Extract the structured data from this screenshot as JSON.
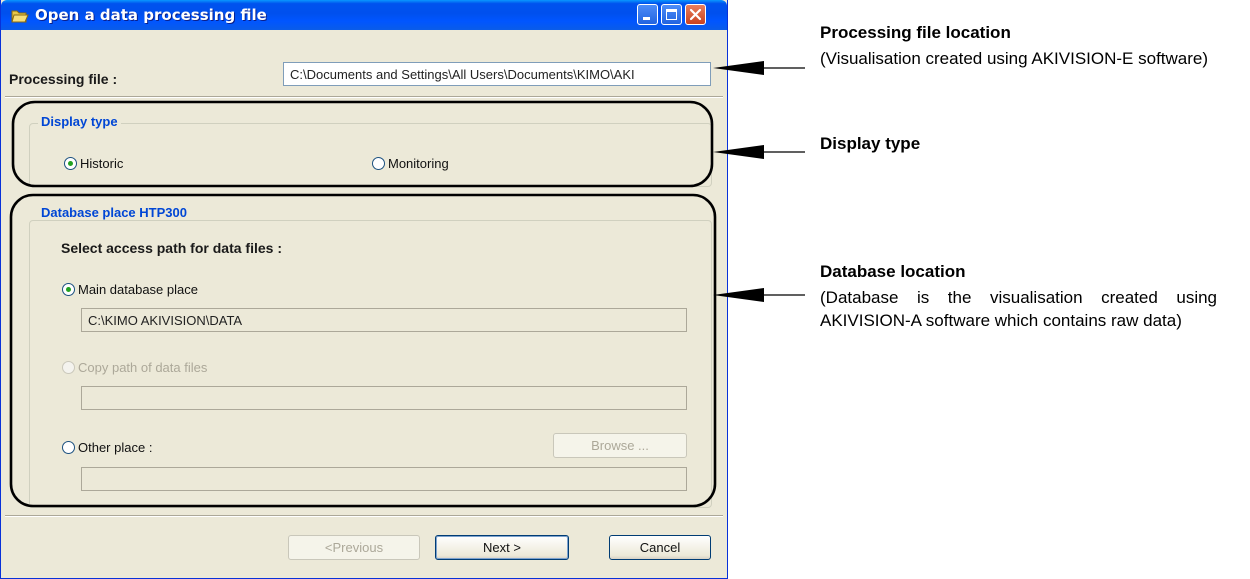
{
  "window": {
    "title": "Open a data processing file",
    "icon": "folder-open-icon",
    "controls": [
      "minimize-icon",
      "maximize-icon",
      "close-icon"
    ]
  },
  "processing_file": {
    "label": "Processing file :",
    "value": "C:\\Documents and Settings\\All Users\\Documents\\KIMO\\AKI"
  },
  "display_type": {
    "title": "Display type",
    "options": [
      {
        "label": "Historic",
        "selected": true
      },
      {
        "label": "Monitoring",
        "selected": false
      }
    ]
  },
  "database": {
    "title": "Database place HTP300",
    "prompt": "Select access path for data files :",
    "main": {
      "label": "Main database place",
      "value": "C:\\KIMO AKIVISION\\DATA",
      "selected": true
    },
    "copy": {
      "label": "Copy path of data files",
      "value": "",
      "enabled": false
    },
    "other": {
      "label": "Other place :",
      "value": "",
      "browse_label": "Browse ..."
    }
  },
  "footer": {
    "previous_label": "<Previous",
    "next_label": "Next >",
    "cancel_label": "Cancel"
  },
  "annotations": {
    "processing": {
      "title": "Processing file location",
      "desc": "(Visualisation created using AKIVISION-E software)"
    },
    "display": {
      "title": "Display type"
    },
    "database": {
      "title": "Database location",
      "desc": "(Database is the visualisation created using AKIVISION-A software which contains raw data)"
    }
  },
  "colors": {
    "title_bar": "#0055ff",
    "group_title": "#0046d5",
    "dialog_bg": "#ece9d8",
    "radio_dot": "#21a121"
  }
}
